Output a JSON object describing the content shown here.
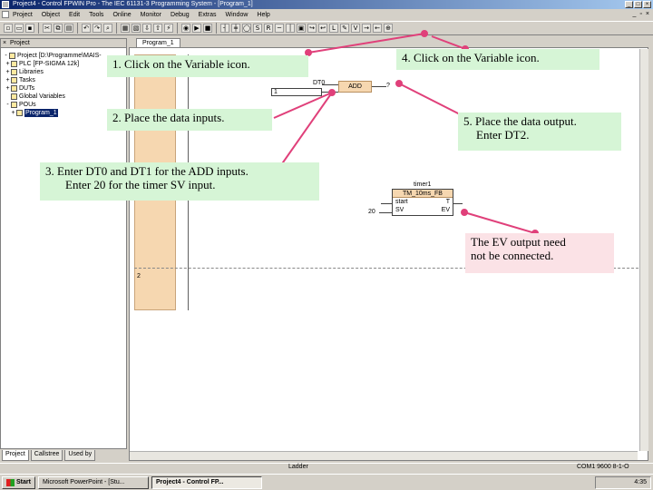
{
  "window": {
    "title": "Project4 - Control FPWIN Pro - The IEC 61131-3 Programming System - [Program_1]"
  },
  "menu": [
    "Project",
    "Object",
    "Edit",
    "Tools",
    "Online",
    "Monitor",
    "Debug",
    "Extras",
    "Window",
    "Help"
  ],
  "tree": {
    "header": "Project",
    "items": [
      {
        "label": "Project [D:\\Programme\\MAIS-",
        "exp": "-"
      },
      {
        "label": "PLC [FP-SIGMA 12k]",
        "exp": "+"
      },
      {
        "label": "Libraries",
        "exp": "+"
      },
      {
        "label": "Tasks",
        "exp": "+"
      },
      {
        "label": "DUTs",
        "exp": "+"
      },
      {
        "label": "Global Variables",
        "exp": ""
      },
      {
        "label": "POUs",
        "exp": "-"
      },
      {
        "label": "Program_1",
        "exp": "+"
      }
    ],
    "tabs": [
      "Project",
      "Callstree",
      "Used by"
    ]
  },
  "editor": {
    "tab": "Program_1",
    "add_block": "ADD",
    "add_top_input": "DT0",
    "add_left_input": "1",
    "add_output": "?",
    "timer_instance": "timer1",
    "timer_type": "TM_10ms_FB",
    "timer_start": "start",
    "timer_q": "T",
    "timer_sv": "SV",
    "timer_ev": "EV",
    "timer_sv_value": "20",
    "row_label": "2"
  },
  "callouts": {
    "c1": "1. Click on the Variable icon.",
    "c2": "2. Place the data inputs.",
    "c3a": "3. Enter DT0 and DT1 for the ADD inputs.",
    "c3b": "Enter 20 for the timer SV input.",
    "c4": "4. Click on the Variable icon.",
    "c5a": "5. Place the data output.",
    "c5b": "Enter DT2.",
    "c6a": "The EV output need",
    "c6b": "not be connected."
  },
  "statusbar": {
    "mode": "Ladder",
    "port": "COM1 9600 8-1-O"
  },
  "taskbar": {
    "start": "Start",
    "items": [
      "Microsoft PowerPoint - [Stu...",
      "Project4 - Control FP..."
    ],
    "clock": "4:35"
  },
  "colors": {
    "callout_green": "#d6f5d6",
    "callout_pink": "#fbe2e6",
    "arrow": "#e0407a",
    "declaration_bg": "#f6d7b0"
  }
}
